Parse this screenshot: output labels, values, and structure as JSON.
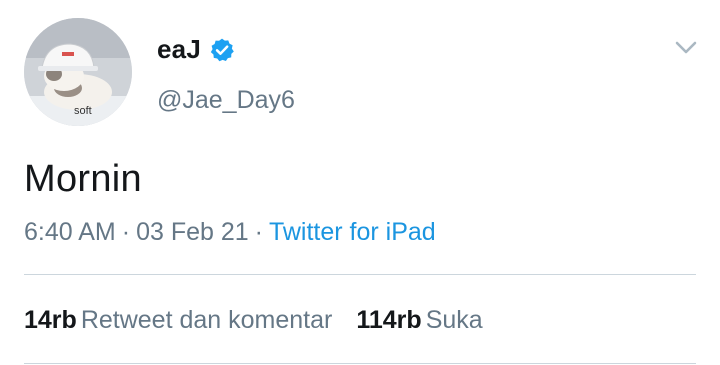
{
  "user": {
    "display_name": "eaJ",
    "handle": "@Jae_Day6",
    "verified": true,
    "avatar_caption": "soft"
  },
  "tweet": {
    "text": "Mornin",
    "time": "6:40 AM",
    "date": "03 Feb 21",
    "separator": "·",
    "source": "Twitter for iPad"
  },
  "stats": {
    "retweets_count": "14rb",
    "retweets_label": "Retweet dan komentar",
    "likes_count": "114rb",
    "likes_label": "Suka"
  },
  "icons": {
    "verified": "verified-badge-icon",
    "menu": "chevron-down-icon"
  },
  "colors": {
    "verified_blue": "#1da1f2",
    "link_blue": "#1b95e0",
    "secondary_text": "#657786",
    "primary_text": "#14171a",
    "divider": "#ccd6dd"
  }
}
